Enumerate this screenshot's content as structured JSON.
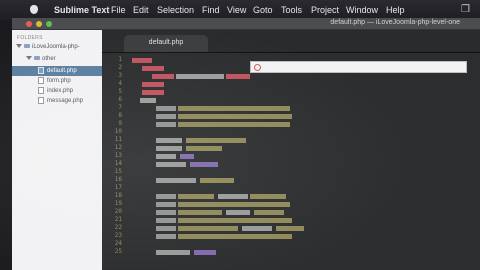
{
  "menubar": {
    "app_name": "Sublime Text",
    "items": [
      "File",
      "Edit",
      "Selection",
      "Find",
      "View",
      "Goto",
      "Tools",
      "Project",
      "Window",
      "Help"
    ]
  },
  "window": {
    "title": "default.php — iLoveJoomla-php-level-one"
  },
  "sidebar": {
    "header": "FOLDERS",
    "root": "iLoveJoomla-php-",
    "folder": "other",
    "files": [
      "default.php",
      "form.php",
      "index.php",
      "message.php"
    ],
    "selected": "default.php"
  },
  "tabs": [
    {
      "label": "default.php",
      "active": true
    }
  ],
  "editor": {
    "language": "php",
    "line_numbers": [
      "1",
      "2",
      "3",
      "4",
      "5",
      "6",
      "7",
      "8",
      "9",
      "10",
      "11",
      "12",
      "13",
      "14",
      "15",
      "16",
      "17",
      "18",
      "19",
      "20",
      "21",
      "22",
      "23",
      "24",
      "25"
    ]
  },
  "colors": {
    "tag": "#f06270",
    "string": "#e3d67b",
    "number": "#b18cf0",
    "background": "#2c2d2e",
    "gutter": "#8e8a63"
  }
}
